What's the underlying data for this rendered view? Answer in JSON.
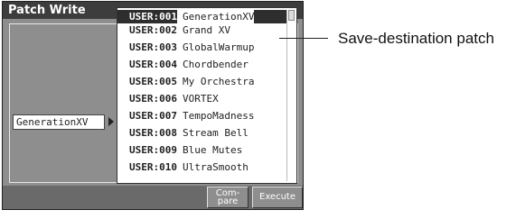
{
  "window": {
    "title": "Patch Write"
  },
  "source_patch": {
    "name": "GenerationXV"
  },
  "patch_list": {
    "rows": [
      {
        "number": "USER:001",
        "name": "GenerationXV",
        "selected": true
      },
      {
        "number": "USER:002",
        "name": "Grand XV",
        "selected": false
      },
      {
        "number": "USER:003",
        "name": "GlobalWarmup",
        "selected": false
      },
      {
        "number": "USER:004",
        "name": "Chordbender",
        "selected": false
      },
      {
        "number": "USER:005",
        "name": "My Orchestra",
        "selected": false
      },
      {
        "number": "USER:006",
        "name": "VORTEX",
        "selected": false
      },
      {
        "number": "USER:007",
        "name": "TempoMadness",
        "selected": false
      },
      {
        "number": "USER:008",
        "name": "Stream Bell",
        "selected": false
      },
      {
        "number": "USER:009",
        "name": "Blue Mutes",
        "selected": false
      },
      {
        "number": "USER:010",
        "name": "UltraSmooth",
        "selected": false
      }
    ]
  },
  "buttons": {
    "compare_line1": "Com-",
    "compare_line2": "pare",
    "execute": "Execute"
  },
  "annotation": {
    "label": "Save-destination patch"
  }
}
